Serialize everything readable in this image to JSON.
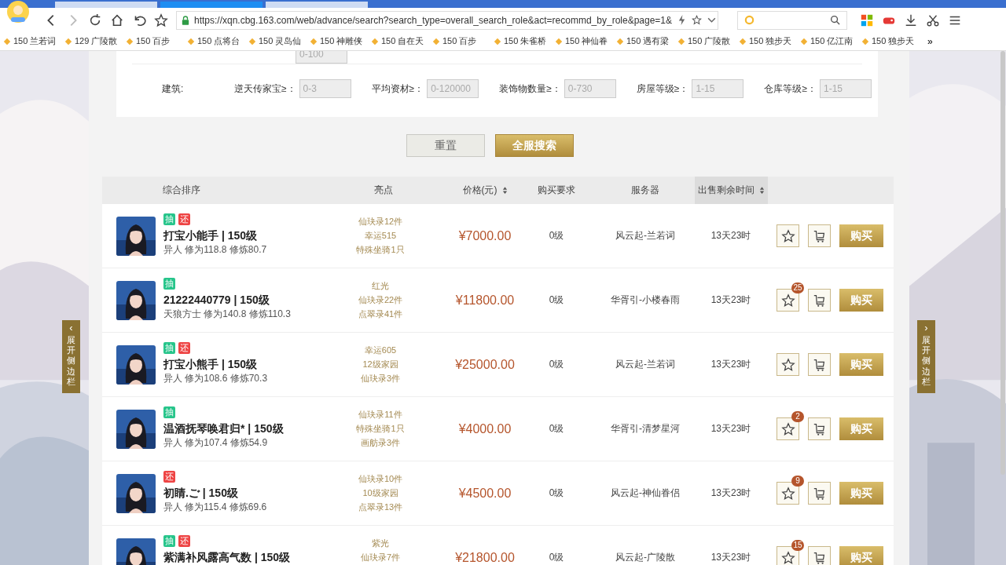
{
  "browser": {
    "tabs": [
      {
        "selected": false
      },
      {
        "selected": true
      },
      {
        "selected": false
      }
    ],
    "more_bookmarks": "»",
    "url": "https://xqn.cbg.163.com/web/advance/search?search_type=overall_search_role&act=recommd_by_role&page=1&",
    "bookmarks": [
      "150 兰若词",
      "129 广陵散",
      "150 百步",
      "150 点将台",
      "150 灵岛仙",
      "150 神雕侠",
      "150 自在天",
      "150 百步",
      "150 朱雀桥",
      "150 神仙眷",
      "150 遇有梁",
      "150 广陵散",
      "150 独步天",
      "150 亿江南",
      "150 独步天"
    ]
  },
  "filters": {
    "partial_field": {
      "placeholder": "0-100"
    },
    "group_label": "建筑:",
    "fields": [
      {
        "label": "逆天传家宝≥：",
        "placeholder": "0-3"
      },
      {
        "label": "平均资材≥：",
        "placeholder": "0-120000"
      },
      {
        "label": "装饰物数量≥：",
        "placeholder": "0-730"
      },
      {
        "label": "房屋等级≥：",
        "placeholder": "1-15"
      },
      {
        "label": "仓库等级≥：",
        "placeholder": "1-15"
      }
    ]
  },
  "buttons": {
    "reset": "重置",
    "search": "全服搜索"
  },
  "table": {
    "columns": [
      {
        "label": "综合排序",
        "sortable": false,
        "selected": false
      },
      {
        "label": "亮点",
        "sortable": false,
        "selected": false
      },
      {
        "label": "价格(元)",
        "sortable": true,
        "selected": false
      },
      {
        "label": "购买要求",
        "sortable": false,
        "selected": false
      },
      {
        "label": "服务器",
        "sortable": false,
        "selected": false
      },
      {
        "label": "出售剩余时间",
        "sortable": true,
        "selected": true
      }
    ],
    "rows": [
      {
        "tags": [
          {
            "label": "抽",
            "color": "#27c58b"
          },
          {
            "label": "还",
            "color": "#ee4444"
          }
        ],
        "name": "打宝小能手 | 150级",
        "stats": "异人 修为118.8 修炼80.7",
        "highlights": [
          "仙玦录12件",
          "幸运515",
          "特殊坐骑1只"
        ],
        "price": "¥7000.00",
        "requirement": "0级",
        "server": "风云起-兰若词",
        "time_left": "13天23时",
        "buy": "购买"
      },
      {
        "tags": [
          {
            "label": "抽",
            "color": "#27c58b"
          }
        ],
        "name": "21222440779 | 150级",
        "stats": "天狼方士 修为140.8 修炼110.3",
        "highlights": [
          "红光",
          "仙玦录22件",
          "点翠录41件"
        ],
        "price": "¥11800.00",
        "requirement": "0级",
        "server": "华胥引-小楼春雨",
        "time_left": "13天23时",
        "favorites": "25",
        "buy": "购买"
      },
      {
        "tags": [
          {
            "label": "抽",
            "color": "#27c58b"
          },
          {
            "label": "还",
            "color": "#ee4444"
          }
        ],
        "name": "打宝小熊手 | 150级",
        "stats": "异人 修为108.6 修炼70.3",
        "highlights": [
          "幸运605",
          "12级家园",
          "仙玦录3件"
        ],
        "price": "¥25000.00",
        "requirement": "0级",
        "server": "风云起-兰若词",
        "time_left": "13天23时",
        "buy": "购买"
      },
      {
        "tags": [
          {
            "label": "抽",
            "color": "#27c58b"
          }
        ],
        "name": "温酒抚琴唤君归* | 150级",
        "stats": "异人 修为107.4 修炼54.9",
        "highlights": [
          "仙玦录11件",
          "特殊坐骑1只",
          "画舫录3件"
        ],
        "price": "¥4000.00",
        "requirement": "0级",
        "server": "华胥引-清梦星河",
        "time_left": "13天23时",
        "favorites": "2",
        "buy": "购买"
      },
      {
        "tags": [
          {
            "label": "还",
            "color": "#ee4444"
          }
        ],
        "name": "初睛.ご | 150级",
        "stats": "异人 修为115.4 修炼69.6",
        "highlights": [
          "仙玦录10件",
          "10级家园",
          "点翠录13件"
        ],
        "price": "¥4500.00",
        "requirement": "0级",
        "server": "风云起-神仙眷侣",
        "time_left": "13天23时",
        "favorites": "9",
        "buy": "购买"
      },
      {
        "tags": [
          {
            "label": "抽",
            "color": "#27c58b"
          },
          {
            "label": "还",
            "color": "#ee4444"
          }
        ],
        "name": "紫满补风露高气数 | 150级",
        "highlights": [
          "紫光",
          "仙玦录7件"
        ],
        "price": "¥21800.00",
        "requirement": "0级",
        "server": "风云起-广陵散",
        "time_left": "13天23时",
        "favorites": "15",
        "buy": "购买"
      }
    ]
  },
  "side_tabs": [
    {
      "arrow": "‹",
      "label": "展开侧边栏"
    },
    {
      "arrow": "›",
      "label": "展开侧边栏"
    }
  ]
}
